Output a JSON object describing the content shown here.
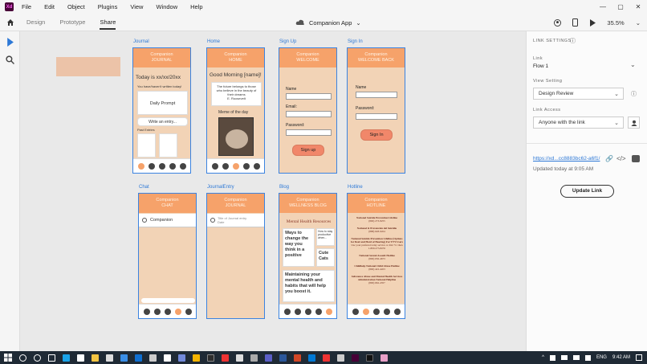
{
  "menu": {
    "logo": "Xd",
    "items": [
      "File",
      "Edit",
      "Object",
      "Plugins",
      "View",
      "Window",
      "Help"
    ]
  },
  "modes": {
    "design": "Design",
    "prototype": "Prototype",
    "share": "Share",
    "document_title": "Companion App",
    "zoom": "35.5%"
  },
  "artboards": {
    "journal": {
      "label": "Journal",
      "header_app": "Companion",
      "header_title": "JOURNAL",
      "today": "Today is xx/xx/20xx",
      "subtitle": "You have/haven't written today!",
      "daily_prompt": "Daily Prompt",
      "write_entry": "Write an entry...",
      "past_entries": "Past Entries"
    },
    "home": {
      "label": "Home",
      "header_app": "Companion",
      "header_title": "HOME",
      "greeting": "Good Morning [name]!",
      "quote": "The future belongs to those who believe in the beauty of their dreams",
      "quote_author": "E. Roosevelt",
      "meme_label": "Meme of the day"
    },
    "signup": {
      "label": "Sign Up",
      "header_app": "Companion",
      "header_title": "WELCOME",
      "name_label": "Name",
      "email_label": "Email:",
      "password_label": "Password:",
      "button": "Sign up"
    },
    "signin": {
      "label": "Sign In",
      "header_app": "Companion",
      "header_title": "WELCOME BACK",
      "name_label": "Name",
      "password_label": "Password:",
      "button": "Sign In"
    },
    "chat": {
      "label": "Chat",
      "header_app": "Companion",
      "header_title": "CHAT",
      "contact": "Companion"
    },
    "journal_entry": {
      "label": "JournalEntry",
      "header_app": "Companion",
      "header_title": "JOURNAL",
      "entry_title": "Title of Journal entry",
      "entry_date": "Date"
    },
    "blog": {
      "label": "Blog",
      "header_app": "Companion",
      "header_title": "WELLNESS BLOG",
      "heading": "Mental Health Resources",
      "card1": "Ways to change the way you think in a positive",
      "card2": "How to stay productive when...",
      "card3": "Cute Cats",
      "card4": "Maintaining your mental health and habits that will help you boost it."
    },
    "hotline": {
      "label": "Hotline",
      "header_app": "Companion",
      "header_title": "HOTLINE",
      "lines": [
        "National Suicide Prevention Lifeline",
        "(800) 273-8255",
        "National & Prevención del Suicidio",
        "(888) 628-9454",
        "National Suicide Prevention Lifeline (Options for Deaf and Hard of Hearing) For TTY Users",
        "Use your preferred relay service or dial 711 then 1-800-273-8255",
        "National Sexual Assault Hotline",
        "(800) 656-4673",
        "Childhelp National Child Abuse Hotline",
        "(800) 422-4453",
        "Substance Abuse and Mental Health Services Administration National Helpline",
        "(800) 662-4357"
      ]
    }
  },
  "panel": {
    "title": "LINK SETTINGS",
    "link_head": "Link",
    "link_value": "Flow 1",
    "view_head": "View Setting",
    "view_value": "Design Review",
    "access_head": "Link Access",
    "access_value": "Anyone with the link",
    "url": "https://xd...cc8883bc62-a6f1/",
    "updated": "Updated today at 9:05 AM",
    "update_button": "Update Link"
  },
  "taskbar": {
    "lang": "ENG",
    "time": "9:42 AM"
  },
  "colors": {
    "artboard_bg": "#f2d3b6",
    "header_orange": "#f6a26a",
    "selection_blue": "#3b83e0",
    "button_salmon": "#f1876a"
  }
}
